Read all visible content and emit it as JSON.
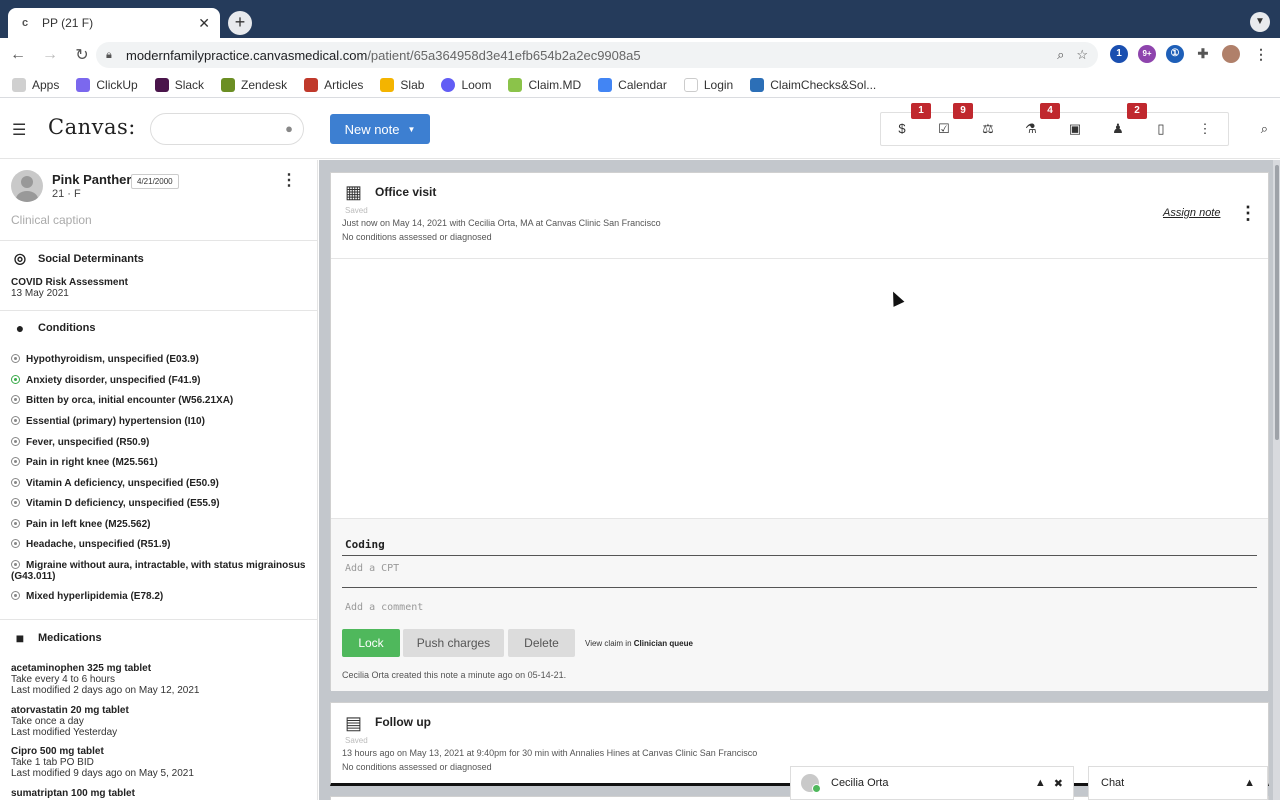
{
  "browser": {
    "tab_title": "PP (21 F)",
    "tab_favicon": "c",
    "url_host": "modernfamilypractice.canvasmedical.com",
    "url_path": "/patient/65a364958d3e41efb654b2a2ec9908a5",
    "ext_badge_1": "1",
    "ext_badge_2": "9+",
    "bookmarks": [
      "Apps",
      "ClickUp",
      "Slack",
      "Zendesk",
      "Articles",
      "Slab",
      "Loom",
      "Claim.MD",
      "Calendar",
      "Login",
      "ClaimChecks&Sol..."
    ]
  },
  "app": {
    "logo": "Canvas:",
    "new_note_label": "New note",
    "badges": [
      "1",
      "9",
      "4",
      "2"
    ]
  },
  "patient": {
    "name": "Pink Panther",
    "dob": "4/21/2000",
    "age_sex": "21 · F",
    "caption": "Clinical caption"
  },
  "social": {
    "heading": "Social Determinants",
    "item": "COVID Risk Assessment",
    "date": "13 May 2021"
  },
  "conditions": {
    "heading": "Conditions",
    "items": [
      "Hypothyroidism, unspecified (E03.9)",
      "Anxiety disorder, unspecified (F41.9)",
      "Bitten by orca, initial encounter (W56.21XA)",
      "Essential (primary) hypertension (I10)",
      "Fever, unspecified (R50.9)",
      "Pain in right knee (M25.561)",
      "Vitamin A deficiency, unspecified (E50.9)",
      "Vitamin D deficiency, unspecified (E55.9)",
      "Pain in left knee (M25.562)",
      "Headache, unspecified (R51.9)",
      "Migraine without aura, intractable, with status migrainosus",
      "Mixed hyperlipidemia (E78.2)"
    ],
    "migraine_code": "(G43.011)"
  },
  "medications": {
    "heading": "Medications",
    "items": [
      {
        "name": "acetaminophen 325 mg tablet",
        "sig": "Take every 4 to 6 hours",
        "modified": "Last modified 2 days ago on May 12, 2021"
      },
      {
        "name": "atorvastatin 20 mg tablet",
        "sig": "Take once a day",
        "modified": "Last modified Yesterday"
      },
      {
        "name": "Cipro 500 mg tablet",
        "sig": "Take 1 tab PO BID",
        "modified": "Last modified 9 days ago on May 5, 2021"
      },
      {
        "name": "sumatriptan 100 mg tablet",
        "sig": "",
        "modified": ""
      }
    ]
  },
  "note1": {
    "title": "Office visit",
    "saved": "Saved",
    "meta": "Just now on May 14, 2021 with Cecilia Orta, MA at Canvas Clinic San Francisco",
    "conditions": "No conditions assessed or diagnosed",
    "assign": "Assign note",
    "coding_label": "Coding",
    "cpt_placeholder": "Add a CPT",
    "comment_placeholder": "Add a comment",
    "lock": "Lock",
    "push": "Push charges",
    "delete": "Delete",
    "view_claim_prefix": "View claim in",
    "view_claim_link": "Clinician queue",
    "created": "Cecilia Orta created this note a minute ago on 05-14-21."
  },
  "note2": {
    "title": "Follow up",
    "saved": "Saved",
    "meta": "13 hours ago on May 13, 2021 at 9:40pm for 30 min with Annalies Hines at Canvas Clinic San Francisco",
    "conditions": "No conditions assessed or diagnosed"
  },
  "chat": {
    "user": "Cecilia Orta",
    "chat_label": "Chat"
  }
}
